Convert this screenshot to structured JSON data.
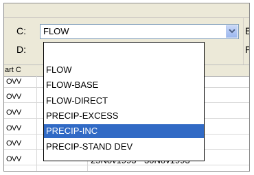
{
  "form": {
    "label_c": "C:",
    "label_d": "D:",
    "right_label_top": "E",
    "right_label_bottom": "F",
    "combo_value": "FLOW"
  },
  "grid": {
    "header_partial": "art C",
    "rows": [
      {
        "col1": "OVV"
      },
      {
        "col1": "OVV"
      },
      {
        "col1": "OVV"
      },
      {
        "col1": "OVV"
      },
      {
        "col1": "OVV"
      },
      {
        "col1": "OVV"
      }
    ],
    "last_row_date": "25Nov1993 - 30Nov1993"
  },
  "dropdown": {
    "items": [
      {
        "label": ""
      },
      {
        "label": "FLOW"
      },
      {
        "label": "FLOW-BASE"
      },
      {
        "label": "FLOW-DIRECT"
      },
      {
        "label": "PRECIP-EXCESS"
      },
      {
        "label": "PRECIP-INC",
        "selected": true
      },
      {
        "label": "PRECIP-STAND DEV"
      }
    ]
  },
  "colors": {
    "selection_bg": "#316ac5",
    "panel_bg": "#ece9d8"
  },
  "icons": {
    "combo_button": "chevron-down-icon"
  }
}
